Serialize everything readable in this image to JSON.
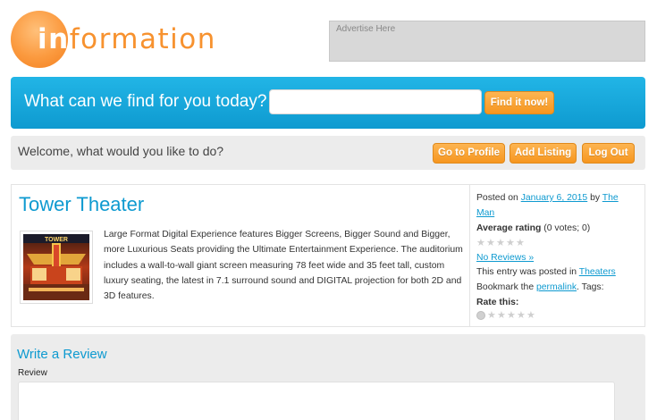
{
  "header": {
    "logo_highlight": "in",
    "logo_rest": "formation",
    "ad_text": "Advertise Here"
  },
  "search": {
    "prompt": "What can we find for you today?",
    "value": "",
    "placeholder": "",
    "button": "Find it now!"
  },
  "welcome": {
    "text": "Welcome, what would you like to do?",
    "buttons": {
      "profile": "Go to Profile",
      "add_listing": "Add Listing",
      "logout": "Log Out"
    }
  },
  "listing": {
    "title": "Tower Theater",
    "description": "Large Format Digital Experience features Bigger Screens, Bigger Sound and Bigger, more Luxurious Seats providing the Ultimate Entertainment Experience. The auditorium includes a wall-to-wall giant screen measuring 78 feet wide and 35 feet tall, custom luxury seating, the latest in 7.1 surround sound and DIGITAL projection for both 2D and 3D features.",
    "thumb_sign": "TOWER"
  },
  "sidebar": {
    "posted_on_prefix": "Posted on",
    "date": "January 6, 2015",
    "by": "by",
    "author_line1": "The",
    "author_line2": "Man",
    "avg_label": "Average rating",
    "avg_votes": "(0 votes; 0)",
    "avg_stars": 0,
    "no_reviews": "No Reviews »",
    "posted_in_prefix": "This entry was posted in",
    "category": "Theaters",
    "bookmark_prefix": "Bookmark the",
    "permalink": "permalink",
    "tags": ". Tags:",
    "rate_label": "Rate this:"
  },
  "review": {
    "title": "Write a Review",
    "label": "Review",
    "value": ""
  },
  "colors": {
    "accent": "#0e9ad0",
    "orange": "#f7922f",
    "button_orange": "#f6961f",
    "panel_gray": "#ececec"
  }
}
